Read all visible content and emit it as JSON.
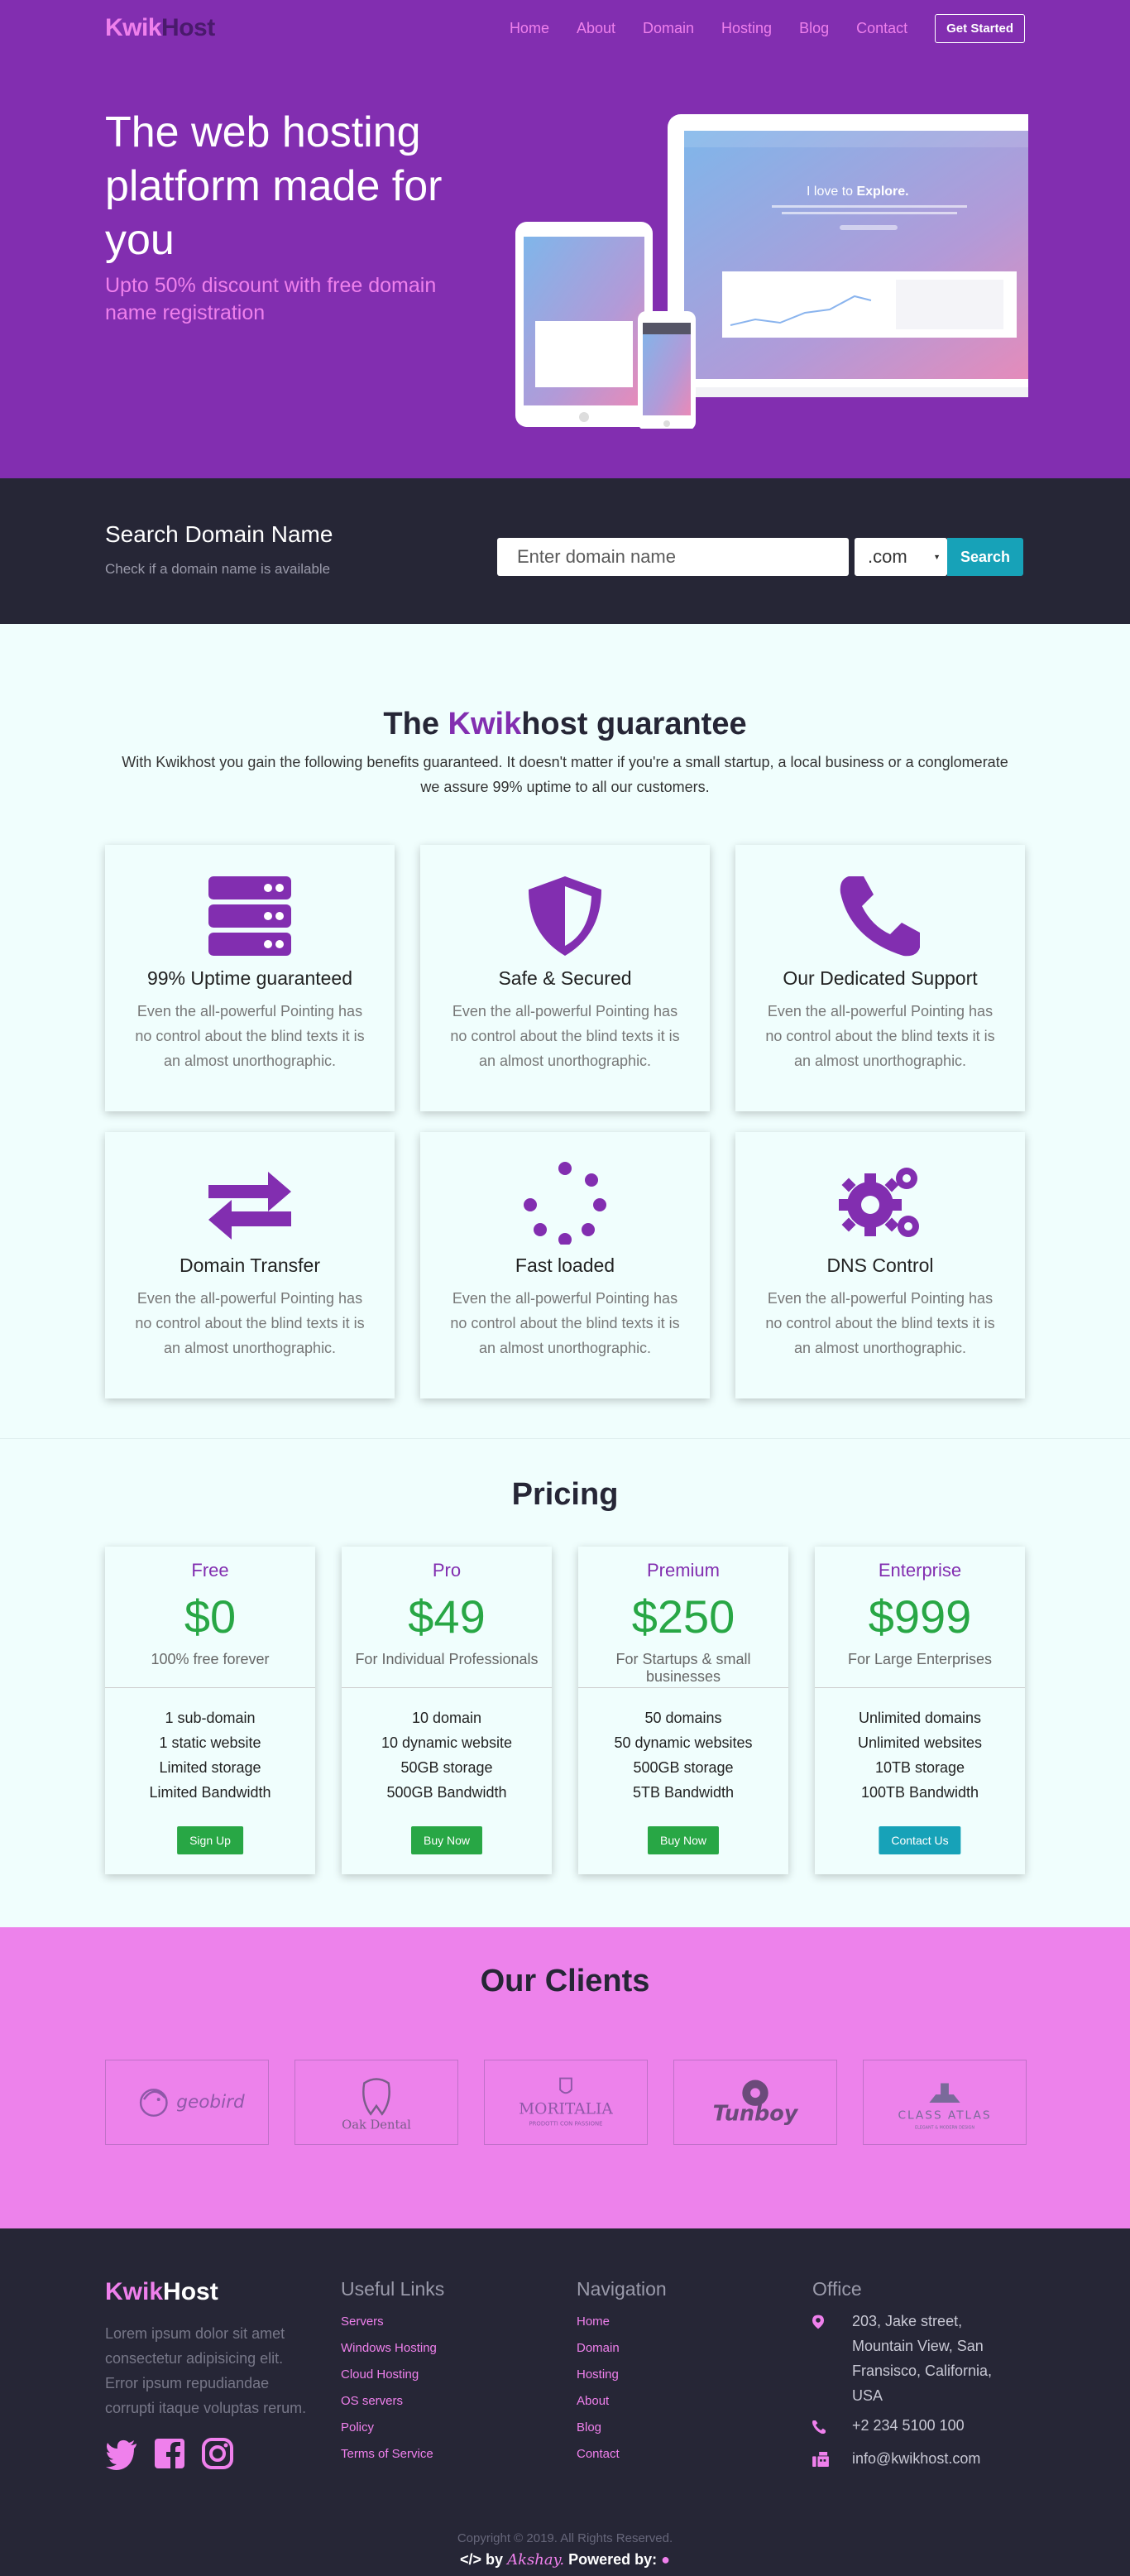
{
  "brand": {
    "part1": "Kwik",
    "part2": "Host"
  },
  "nav": {
    "items": [
      "Home",
      "About",
      "Domain",
      "Hosting",
      "Blog",
      "Contact"
    ],
    "cta": "Get Started"
  },
  "hero": {
    "title": "The web hosting platform made for you",
    "subtitle": "Upto 50% discount with free domain name registration",
    "mock_heading": "I love to",
    "mock_heading_bold": "Explore."
  },
  "search": {
    "title": "Search Domain Name",
    "subtitle": "Check if a domain name is available",
    "placeholder": "Enter domain name",
    "tld_selected": ".com",
    "button": "Search"
  },
  "guarantee": {
    "title_part1": "The ",
    "title_kwik": "Kwik",
    "title_part2": "host guarantee",
    "description": "With Kwikhost you gain the following benefits guaranteed. It doesn't matter if you're a small startup, a local business or a conglomerate we assure 99% uptime to all our customers.",
    "features": [
      {
        "icon": "server-icon",
        "title": "99% Uptime guaranteed",
        "text": "Even the all-powerful Pointing has no control about the blind texts it is an almost unorthographic."
      },
      {
        "icon": "shield-icon",
        "title": "Safe & Secured",
        "text": "Even the all-powerful Pointing has no control about the blind texts it is an almost unorthographic."
      },
      {
        "icon": "phone-icon",
        "title": "Our Dedicated Support",
        "text": "Even the all-powerful Pointing has no control about the blind texts it is an almost unorthographic."
      },
      {
        "icon": "exchange-icon",
        "title": "Domain Transfer",
        "text": "Even the all-powerful Pointing has no control about the blind texts it is an almost unorthographic."
      },
      {
        "icon": "spinner-icon",
        "title": "Fast loaded",
        "text": "Even the all-powerful Pointing has no control about the blind texts it is an almost unorthographic."
      },
      {
        "icon": "gears-icon",
        "title": "DNS Control",
        "text": "Even the all-powerful Pointing has no control about the blind texts it is an almost unorthographic."
      }
    ]
  },
  "pricing": {
    "title": "Pricing",
    "plans": [
      {
        "name": "Free",
        "price": "$0",
        "desc": "100% free forever",
        "features": [
          "1 sub-domain",
          "1 static website",
          "Limited storage",
          "Limited Bandwidth"
        ],
        "button": "Sign Up"
      },
      {
        "name": "Pro",
        "price": "$49",
        "desc": "For Individual Professionals",
        "features": [
          "10 domain",
          "10 dynamic website",
          "50GB storage",
          "500GB Bandwidth"
        ],
        "button": "Buy Now"
      },
      {
        "name": "Premium",
        "price": "$250",
        "desc": "For Startups & small businesses",
        "features": [
          "50 domains",
          "50 dynamic websites",
          "500GB storage",
          "5TB Bandwidth"
        ],
        "button": "Buy Now"
      },
      {
        "name": "Enterprise",
        "price": "$999",
        "desc": "For Large Enterprises",
        "features": [
          "Unlimited domains",
          "Unlimited websites",
          "10TB storage",
          "100TB Bandwidth"
        ],
        "button": "Contact Us"
      }
    ]
  },
  "clients": {
    "title": "Our Clients",
    "logos": [
      "geobird",
      "Oak Dental",
      "MORITALIA",
      "Tunboy",
      "CLASS ATLAS"
    ],
    "logo_subtexts": [
      "PRODOTTI CON PASSIONE",
      "ELEGANT & MODERN DESIGN"
    ]
  },
  "footer": {
    "about": "Lorem ipsum dolor sit amet consectetur adipisicing elit. Error ipsum repudiandae corrupti itaque voluptas rerum.",
    "useful_links": {
      "title": "Useful Links",
      "items": [
        "Servers",
        "Windows Hosting",
        "Cloud Hosting",
        "OS servers",
        "Policy",
        "Terms of Service"
      ]
    },
    "navigation": {
      "title": "Navigation",
      "items": [
        "Home",
        "Domain",
        "Hosting",
        "About",
        "Blog",
        "Contact"
      ]
    },
    "office": {
      "title": "Office",
      "address": "203, Jake street, Mountain View, San Fransisco, California, USA",
      "phone": "+2 234 5100 100",
      "email": "info@kwikhost.com"
    },
    "copyright": "Copyright © 2019. All Rights Reserved.",
    "credit_by": "by",
    "credit_author": "Akshay.",
    "credit_powered": "Powered by:"
  },
  "colors": {
    "purple": "#822eb0",
    "pink": "#ef80ec",
    "dark": "#262636",
    "green": "#28a745",
    "teal": "#17a2b8",
    "bg": "#f0fefd"
  }
}
